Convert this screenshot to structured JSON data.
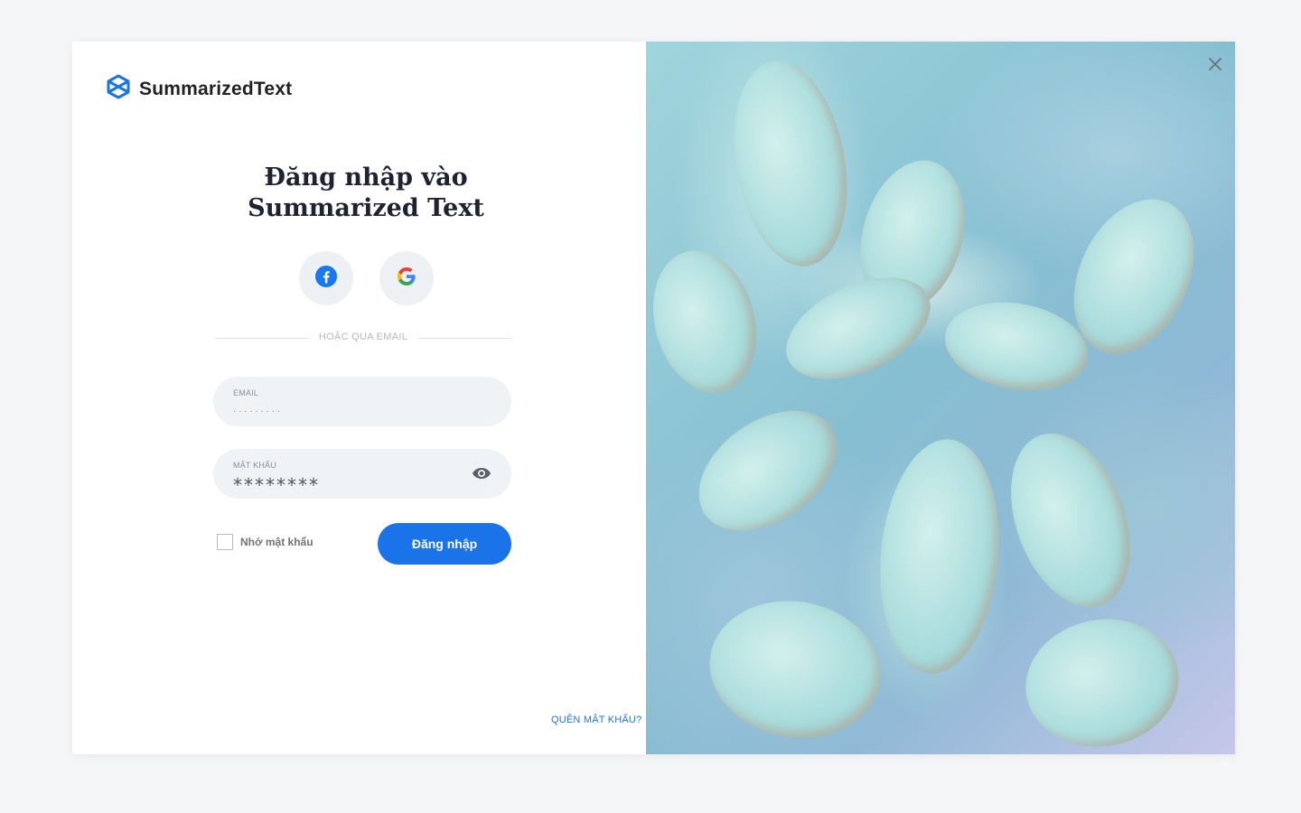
{
  "brand": {
    "name": "SummarizedText",
    "accent": "#1a73e8"
  },
  "heading": {
    "line1": "Đăng nhập vào",
    "line2": "Summarized Text"
  },
  "social": {
    "facebook_icon": "facebook-icon",
    "google_icon": "google-icon"
  },
  "divider_text": "HOẶC QUA EMAIL",
  "email": {
    "label": "EMAIL",
    "value": ". . . . . . . . ."
  },
  "password": {
    "label": "MẬT KHẨU",
    "value": "********",
    "toggle_icon": "eye-icon"
  },
  "remember": {
    "label": "Nhớ mật khẩu",
    "checked": false
  },
  "login_button": "Đăng nhập",
  "forgot_link": "QUÊN MẬT KHẨU?",
  "close_icon": "close-icon"
}
